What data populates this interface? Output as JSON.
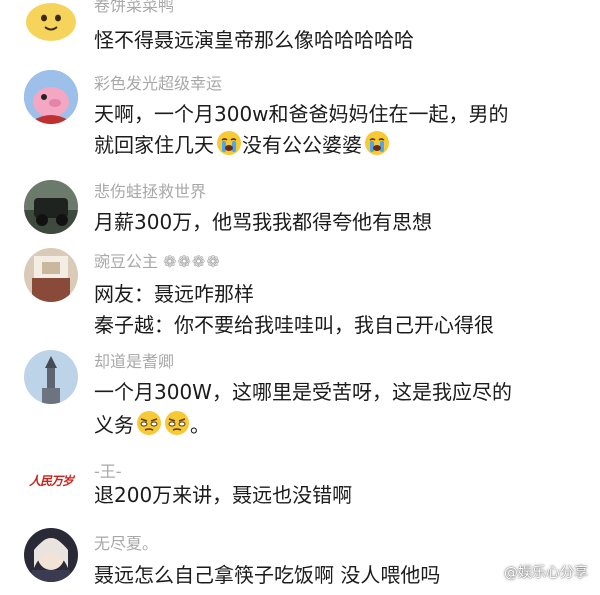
{
  "comments": [
    {
      "username": "卷饼菜菜鸭",
      "lines": [
        "怪不得聂远演皇帝那么像哈哈哈哈哈"
      ]
    },
    {
      "username": "彩色发光超级幸运",
      "lines": [
        "天啊，一个月300w和爸爸妈妈住在一起，男的",
        "就回家住几天",
        "没有公公婆婆"
      ]
    },
    {
      "username": "悲伤蛙拯救世界",
      "lines": [
        "月薪300万，他骂我我都得夸他有思想"
      ]
    },
    {
      "username": "豌豆公主",
      "lines": [
        "网友：聂远咋那样",
        "秦子越：你不要给我哇哇叫，我自己开心得很"
      ]
    },
    {
      "username": "却道是耆卿",
      "lines": [
        "一个月300W，这哪里是受苦呀，这是我应尽的",
        "义务",
        "。"
      ]
    },
    {
      "username": "-王-",
      "lines": [
        "退200万来讲，聂远也没错啊"
      ]
    },
    {
      "username": "无尽夏。",
      "lines": [
        "聂远怎么自己拿筷子吃饭啊 没人喂他吗"
      ]
    }
  ],
  "avatars": {
    "a6_text": "人民万岁"
  },
  "watermark": "@娱乐心分享"
}
